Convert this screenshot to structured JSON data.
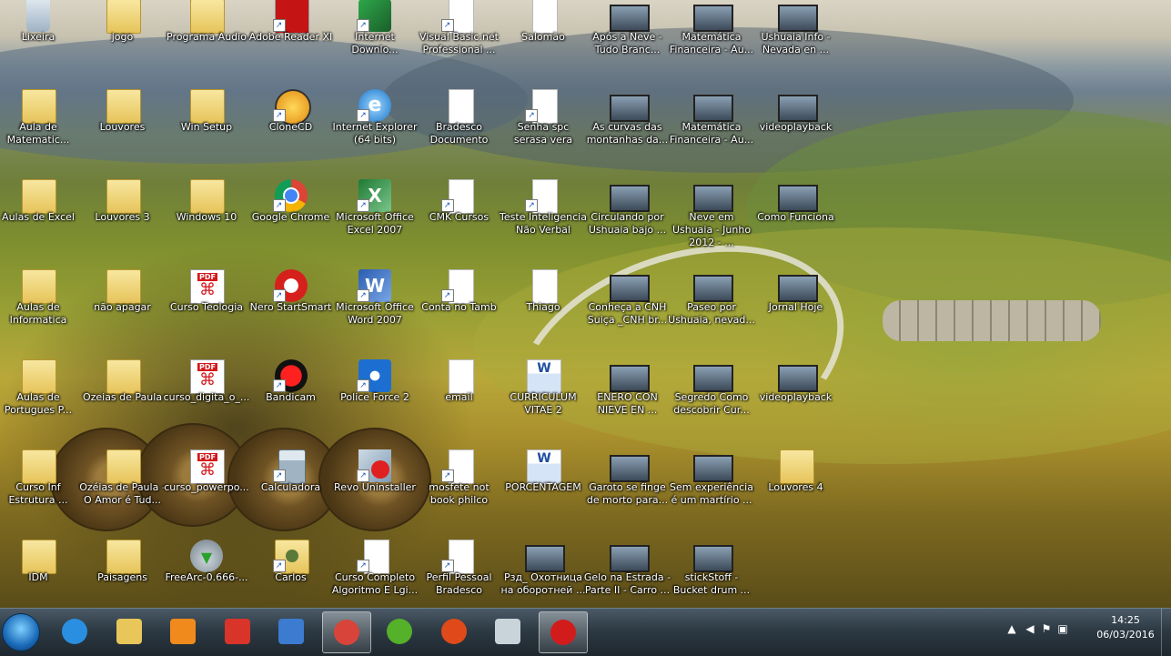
{
  "desktop": {
    "icons": [
      {
        "label": "Lixeira",
        "kind": "recycle",
        "glyph": "recycle-bin-icon"
      },
      {
        "label": "jogo",
        "kind": "folder",
        "glyph": "folder-icon"
      },
      {
        "label": "Programa Audio",
        "kind": "folder",
        "glyph": "folder-icon"
      },
      {
        "label": "Adobe Reader XI",
        "kind": "pdfapp",
        "glyph": "adobe-reader-icon"
      },
      {
        "label": "Internet Downlo...",
        "kind": "idm",
        "glyph": "download-manager-icon"
      },
      {
        "label": "Visual Basic.net Professional ...",
        "kind": "doc",
        "glyph": "document-icon"
      },
      {
        "label": "Salomão",
        "kind": "doc",
        "glyph": "document-icon"
      },
      {
        "label": "Após a Neve - Tudo Branc...",
        "kind": "video",
        "glyph": "video-icon"
      },
      {
        "label": "Matemática Financeira - Au...",
        "kind": "video",
        "glyph": "video-icon"
      },
      {
        "label": "Ushuaia Info - Nevada en ...",
        "kind": "video",
        "glyph": "video-icon"
      },
      {
        "label": "Aula de Matematic...",
        "kind": "folder",
        "glyph": "folder-icon"
      },
      {
        "label": "Louvores",
        "kind": "folder",
        "glyph": "folder-icon"
      },
      {
        "label": "Win Setup",
        "kind": "folder",
        "glyph": "folder-icon"
      },
      {
        "label": "CloneCD",
        "kind": "clonecd",
        "glyph": "clonecd-sheep-icon"
      },
      {
        "label": "Internet Explorer (64 bits)",
        "kind": "ie",
        "glyph": "internet-explorer-icon"
      },
      {
        "label": "Bradesco Documento",
        "kind": "doc",
        "glyph": "document-icon"
      },
      {
        "label": "Senha spc serasa vera",
        "kind": "doc",
        "glyph": "document-icon"
      },
      {
        "label": "As curvas das montanhas da...",
        "kind": "video",
        "glyph": "video-icon"
      },
      {
        "label": "Matemática Financeira - Au...",
        "kind": "video",
        "glyph": "video-icon"
      },
      {
        "label": "videoplayback",
        "kind": "video",
        "glyph": "video-icon"
      },
      {
        "label": "Aulas de Excel",
        "kind": "folder",
        "glyph": "folder-icon"
      },
      {
        "label": "Louvores 3",
        "kind": "folder",
        "glyph": "folder-icon"
      },
      {
        "label": "Windows 10",
        "kind": "folder",
        "glyph": "folder-icon"
      },
      {
        "label": "Google Chrome",
        "kind": "chrome",
        "glyph": "chrome-icon"
      },
      {
        "label": "Microsoft Office Excel 2007",
        "kind": "excel",
        "glyph": "excel-icon"
      },
      {
        "label": "CMK Cursos",
        "kind": "doc",
        "glyph": "document-icon"
      },
      {
        "label": "Teste Inteligencia Não Verbal",
        "kind": "doc",
        "glyph": "document-icon"
      },
      {
        "label": "Circulando por Ushuaia bajo ...",
        "kind": "video",
        "glyph": "video-icon"
      },
      {
        "label": "Neve em Ushuaia - Junho 2012 - ...",
        "kind": "video",
        "glyph": "video-icon"
      },
      {
        "label": "Como Funciona",
        "kind": "video",
        "glyph": "video-icon"
      },
      {
        "label": "Aulas de Informatica",
        "kind": "folder",
        "glyph": "folder-icon"
      },
      {
        "label": "não apagar",
        "kind": "folder",
        "glyph": "folder-icon"
      },
      {
        "label": "Curso Teologia",
        "kind": "pdf",
        "glyph": "pdf-icon"
      },
      {
        "label": "Nero StartSmart",
        "kind": "nero",
        "glyph": "nero-icon"
      },
      {
        "label": "Microsoft Office Word 2007",
        "kind": "word",
        "glyph": "word-icon"
      },
      {
        "label": "Conta no Tamb",
        "kind": "doc",
        "glyph": "document-icon"
      },
      {
        "label": "Thiago",
        "kind": "doc",
        "glyph": "document-icon"
      },
      {
        "label": "Conheça a CNH Suiça _CNH br...",
        "kind": "video",
        "glyph": "video-icon"
      },
      {
        "label": "Paseo por Ushuaia, nevad...",
        "kind": "video",
        "glyph": "video-icon"
      },
      {
        "label": "Jornal Hoje",
        "kind": "video",
        "glyph": "video-icon"
      },
      {
        "label": "Aulas de Portugues P...",
        "kind": "folder",
        "glyph": "folder-icon"
      },
      {
        "label": "Ozeias de Paula",
        "kind": "folder",
        "glyph": "folder-icon"
      },
      {
        "label": "curso_digita_o_...",
        "kind": "pdf",
        "glyph": "pdf-icon"
      },
      {
        "label": "Bandicam",
        "kind": "bandicam",
        "glyph": "bandicam-icon"
      },
      {
        "label": "Police Force 2",
        "kind": "police",
        "glyph": "police-force-icon"
      },
      {
        "label": "email",
        "kind": "doc",
        "glyph": "document-icon"
      },
      {
        "label": "CURRICULUM VITAE 2",
        "kind": "worddoc",
        "glyph": "word-document-icon"
      },
      {
        "label": "ENERO CON NIEVE EN ...",
        "kind": "video",
        "glyph": "video-icon"
      },
      {
        "label": "Segredo Como descobrir Cur...",
        "kind": "video",
        "glyph": "video-icon"
      },
      {
        "label": "videoplayback",
        "kind": "video",
        "glyph": "video-icon"
      },
      {
        "label": "Curso Inf Estrutura ...",
        "kind": "folder",
        "glyph": "folder-icon"
      },
      {
        "label": "Ozéias de Paula - O Amor é Tud...",
        "kind": "folder",
        "glyph": "folder-icon"
      },
      {
        "label": "curso_powerpo...",
        "kind": "pdf",
        "glyph": "pdf-icon"
      },
      {
        "label": "Calculadora",
        "kind": "calc",
        "glyph": "calculator-icon"
      },
      {
        "label": "Revo Uninstaller",
        "kind": "revo",
        "glyph": "revo-uninstaller-icon"
      },
      {
        "label": "mosfete not book philco",
        "kind": "doc",
        "glyph": "document-icon"
      },
      {
        "label": "PORCENTAGEM",
        "kind": "worddoc",
        "glyph": "word-document-icon"
      },
      {
        "label": "Garoto se finge de morto para...",
        "kind": "video",
        "glyph": "video-icon"
      },
      {
        "label": "Sem experiência é um martírio ...",
        "kind": "video",
        "glyph": "video-icon"
      },
      {
        "label": "Louvores 4",
        "kind": "folder",
        "glyph": "folder-icon"
      },
      {
        "label": "IDM",
        "kind": "folder",
        "glyph": "folder-icon"
      },
      {
        "label": "Paisagens",
        "kind": "folder",
        "glyph": "folder-icon"
      },
      {
        "label": "FreeArc-0.666-...",
        "kind": "freearc",
        "glyph": "freearc-icon"
      },
      {
        "label": "Carlos",
        "kind": "user",
        "glyph": "user-folder-icon"
      },
      {
        "label": "Curso Completo Algoritmo E Lgi...",
        "kind": "doc",
        "glyph": "document-icon"
      },
      {
        "label": "Perfil Pessoal Bradesco",
        "kind": "doc",
        "glyph": "document-icon"
      },
      {
        "label": "Рзд_ Охотница на оборотней ...",
        "kind": "video",
        "glyph": "video-icon"
      },
      {
        "label": "Gelo na Estrada - Parte II - Carro ...",
        "kind": "video",
        "glyph": "video-icon"
      },
      {
        "label": "stickStoff - Bucket drum ...",
        "kind": "video",
        "glyph": "video-icon"
      }
    ]
  },
  "taskbar": {
    "start_glyph": "windows-start-icon",
    "items": [
      {
        "name": "taskbar-internet-explorer",
        "glyph": "internet-explorer-icon",
        "color": "#2a8fe0",
        "active": false
      },
      {
        "name": "taskbar-file-explorer",
        "glyph": "folder-icon",
        "color": "#e8c65a",
        "active": false
      },
      {
        "name": "taskbar-media-player",
        "glyph": "media-player-icon",
        "color": "#f08a1c",
        "active": false
      },
      {
        "name": "taskbar-ccleaner",
        "glyph": "ccleaner-icon",
        "color": "#d8342a",
        "active": false
      },
      {
        "name": "taskbar-app",
        "glyph": "building-icon",
        "color": "#3b7bd0",
        "active": false
      },
      {
        "name": "taskbar-chrome",
        "glyph": "chrome-icon",
        "color": "#d9443a",
        "active": true
      },
      {
        "name": "taskbar-utorrent",
        "glyph": "utorrent-icon",
        "color": "#55b02a",
        "active": false
      },
      {
        "name": "taskbar-flash-app",
        "glyph": "lightning-icon",
        "color": "#e04a1a",
        "active": false
      },
      {
        "name": "taskbar-truck-app",
        "glyph": "truck-icon",
        "color": "#c9d3da",
        "active": false
      },
      {
        "name": "taskbar-bandicam",
        "glyph": "record-icon",
        "color": "#d21c1c",
        "active": true
      }
    ]
  },
  "tray": {
    "time": "14:25",
    "date": "06/03/2016"
  }
}
